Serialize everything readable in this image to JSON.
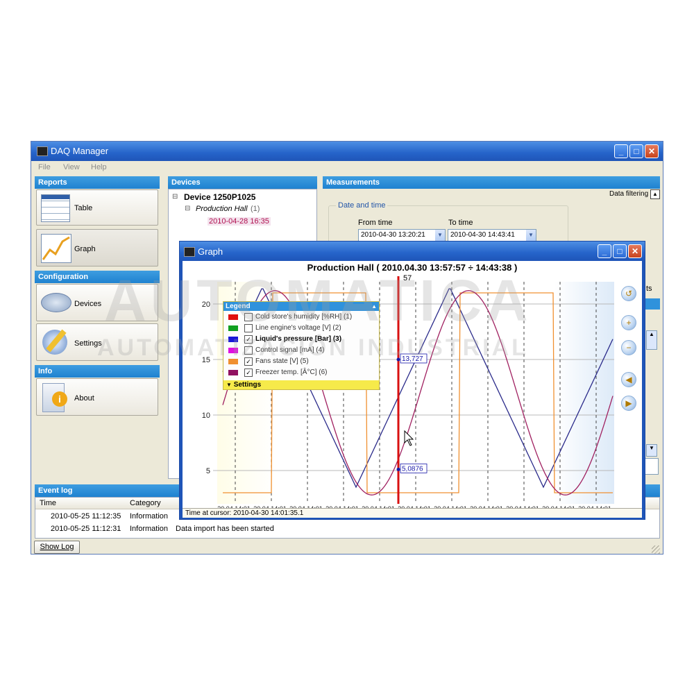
{
  "window": {
    "title": "DAQ Manager"
  },
  "menu": [
    "File",
    "View",
    "Help"
  ],
  "sidebar": {
    "reports_header": "Reports",
    "table_label": "Table",
    "graph_label": "Graph",
    "configuration_header": "Configuration",
    "devices_label": "Devices",
    "settings_label": "Settings",
    "info_header": "Info",
    "about_label": "About"
  },
  "devices_panel": {
    "header": "Devices",
    "device": "Device 1250P1025",
    "location": "Production Hall",
    "location_count": "(1)",
    "date": "2010-04-28 16:35"
  },
  "measurements": {
    "header": "Measurements",
    "data_filtering": "Data filtering",
    "date_and_time": "Date and time",
    "from_label": "From time",
    "to_label": "To time",
    "from_value": "2010-04-30 13:20:21",
    "to_value": "2010-04-30 14:43:41",
    "partial_right": "ts"
  },
  "graph": {
    "window_title": "Graph",
    "chart_title": "Production Hall ( 2010.04.30 13:57:57 ÷ 14:43:38 )",
    "cursor_label": "57",
    "value_label_1": "13,727",
    "value_label_2": "5,0876",
    "status": "Time at cursor: 2010-04-30 14:01:35.1"
  },
  "legend": {
    "title": "Legend",
    "settings": "Settings",
    "items": [
      {
        "label": "Cold store's humidity [%RH] (1)",
        "color": "#e01010",
        "checked": false
      },
      {
        "label": "Line engine's voltage [V] (2)",
        "color": "#10a020",
        "checked": false
      },
      {
        "label": "Liquid's pressure [Bar] (3)",
        "color": "#1818d8",
        "checked": true
      },
      {
        "label": "Control signal [mA] (4)",
        "color": "#e010e0",
        "checked": false
      },
      {
        "label": "Fans state [V] (5)",
        "color": "#f09030",
        "checked": true
      },
      {
        "label": "Freezer temp. [Â°C] (6)",
        "color": "#901060",
        "checked": true
      }
    ]
  },
  "chart_data": {
    "type": "line",
    "title": "Production Hall ( 2010.04.30 13:57:57 ÷ 14:43:38 )",
    "y_ticks": [
      "5",
      "10",
      "15",
      "20"
    ],
    "x_ticks": [
      "30.04 14:01",
      "30.04 14:01",
      "30.04 14:01",
      "30.04 14:01",
      "30.04 14:01",
      "30.04 14:01",
      "30.04 14:01",
      "30.04 14:01",
      "30.04 14:01",
      "30.04 14:01",
      "30.04 14:01"
    ],
    "ylim": [
      2,
      22
    ],
    "series": [
      {
        "name": "Liquid's pressure [Bar] (3)",
        "color": "#2a2a8a",
        "shape": "triangle"
      },
      {
        "name": "Fans state [V] (5)",
        "color": "#f09030",
        "shape": "square"
      },
      {
        "name": "Freezer temp. [Â°C] (6)",
        "color": "#a02060",
        "shape": "sine"
      }
    ]
  },
  "event_log": {
    "header": "Event log",
    "col_time": "Time",
    "col_category": "Category",
    "rows": [
      {
        "time": "2010-05-25 11:12:35",
        "category": "Information",
        "message": ""
      },
      {
        "time": "2010-05-25 11:12:31",
        "category": "Information",
        "message": "Data import has been started"
      }
    ],
    "show_log": "Show Log"
  },
  "watermark": {
    "line1": "AUTOMATICA",
    "line2": "AUTOMATIZACIÓN INDUSTRIAL"
  }
}
